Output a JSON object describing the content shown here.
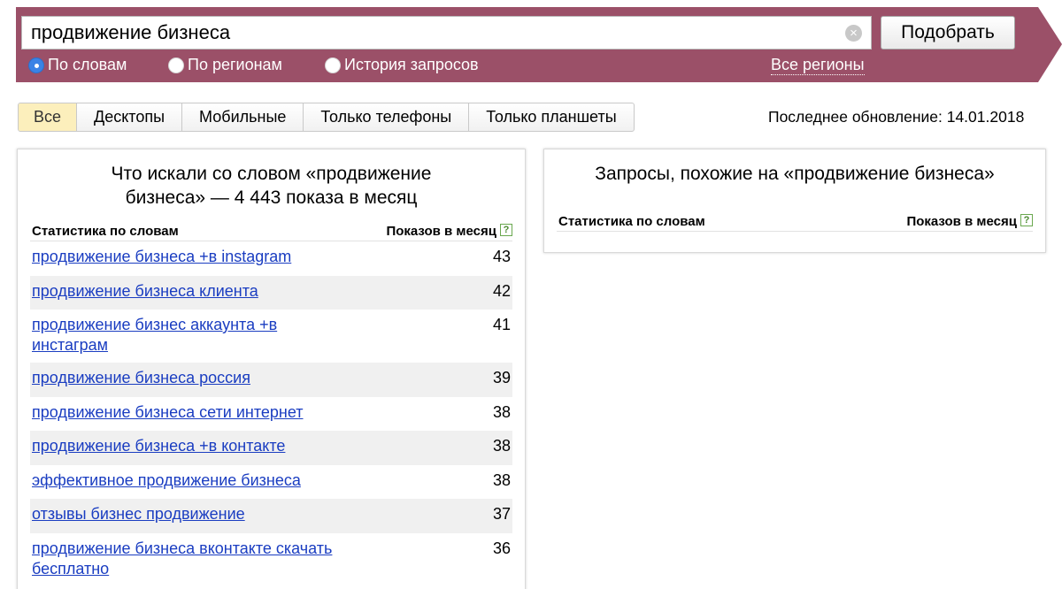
{
  "search": {
    "query": "продвижение бизнеса",
    "button_label": "Подобрать",
    "clear_icon": "×",
    "options": [
      {
        "label": "По словам",
        "checked": true
      },
      {
        "label": "По регионам",
        "checked": false
      },
      {
        "label": "История запросов",
        "checked": false
      }
    ],
    "regions_link": "Все регионы"
  },
  "tabs": [
    {
      "label": "Все",
      "active": true
    },
    {
      "label": "Десктопы",
      "active": false
    },
    {
      "label": "Мобильные",
      "active": false
    },
    {
      "label": "Только телефоны",
      "active": false
    },
    {
      "label": "Только планшеты",
      "active": false
    }
  ],
  "last_update": "Последнее обновление: 14.01.2018",
  "left_panel": {
    "title": "Что искали со словом «продвижение бизнеса» — 4 443 показа в месяц",
    "col_words": "Статистика по словам",
    "col_count": "Показов в месяц",
    "help": "?",
    "rows": [
      {
        "phrase": "продвижение бизнеса +в instagram",
        "count": "43"
      },
      {
        "phrase": "продвижение бизнеса клиента",
        "count": "42"
      },
      {
        "phrase": "продвижение бизнес аккаунта +в инстаграм",
        "count": "41"
      },
      {
        "phrase": "продвижение бизнеса россия",
        "count": "39"
      },
      {
        "phrase": "продвижение бизнеса сети интернет",
        "count": "38"
      },
      {
        "phrase": "продвижение бизнеса +в контакте",
        "count": "38"
      },
      {
        "phrase": "эффективное продвижение бизнеса",
        "count": "38"
      },
      {
        "phrase": "отзывы бизнес продвижение",
        "count": "37"
      },
      {
        "phrase": "продвижение бизнеса вконтакте скачать бесплатно",
        "count": "36"
      }
    ]
  },
  "right_panel": {
    "title": "Запросы, похожие на «продвижение бизнеса»",
    "col_words": "Статистика по словам",
    "col_count": "Показов в месяц",
    "help": "?"
  },
  "colors": {
    "header": "#9b5068",
    "link": "#1a3dc1",
    "active_tab": "#fcefbc",
    "radio_checked": "#3a83e6"
  }
}
